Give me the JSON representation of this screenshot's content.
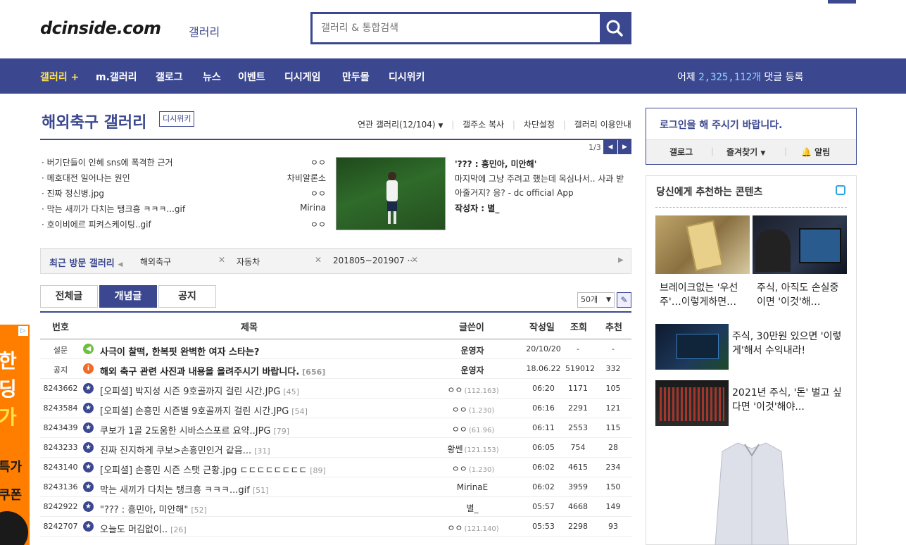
{
  "header": {
    "logo": "dcinside.com",
    "logo_sub": "갤러리",
    "search_placeholder": "갤러리 & 통합검색"
  },
  "nav": {
    "items": [
      "갤러리 +",
      "m.갤러리",
      "갤로그",
      "뉴스",
      "이벤트",
      "디시게임",
      "만두몰",
      "디시위키"
    ],
    "stat_prefix": "어제",
    "stat_count": "2,325,112개",
    "stat_suffix": "댓글 등록"
  },
  "gallery": {
    "title": "해외축구 갤러리",
    "wiki_badge": "디시위키",
    "links": [
      "연관 갤러리(12/104)",
      "갤주소 복사",
      "차단설정",
      "갤러리 이용안내"
    ]
  },
  "issue": {
    "page": "1/3",
    "items": [
      {
        "title": "버기단들이 인혜 sns에 폭격한 근거",
        "writer": "ㅇㅇ"
      },
      {
        "title": "메호대전 일어나는 원인",
        "writer": "차비알론소"
      },
      {
        "title": "진짜 정신병.jpg",
        "writer": "ㅇㅇ"
      },
      {
        "title": "막는 새끼가 다치는 탱크흥 ㅋㅋㅋ...gif",
        "writer": "Mirina"
      },
      {
        "title": "호이비에르 피켜스케이팅..gif",
        "writer": "ㅇㅇ"
      }
    ],
    "headline": "'??? : 흥민아, 미안해'",
    "body": "마지막에 그냥 주려고 했는데 옥심나서.. 사과 받아줄거지? 응? - dc official App",
    "writer_label": "작성자 :",
    "writer": "별_"
  },
  "recent": {
    "label": "최근 방문 갤러리",
    "items": [
      "해외축구",
      "자동차",
      "201805~201907 ···"
    ]
  },
  "tabs": [
    "전체글",
    "개념글",
    "공지"
  ],
  "per_page": "50개",
  "list": {
    "headers": [
      "번호",
      "제목",
      "글쓴이",
      "작성일",
      "조회",
      "추천"
    ],
    "rows": [
      {
        "no": "설문",
        "title": "사극이 찰떡, 한복핏 완벽한 여자 스타는?",
        "comments": "",
        "writer": "운영자",
        "ip": "",
        "date": "20/10/20",
        "views": "-",
        "rec": "-",
        "kind": "survey"
      },
      {
        "no": "공지",
        "title": "해외 축구 관련 사진과 내용을 올려주시기 바랍니다.",
        "comments": "[656]",
        "writer": "운영자",
        "ip": "",
        "date": "18.06.22",
        "views": "519012",
        "rec": "332",
        "kind": "notice"
      },
      {
        "no": "8243662",
        "title": "[오피셜] 박지성 시즌 9호골까지 걸린 시간.JPG",
        "comments": "[45]",
        "writer": "ㅇㅇ",
        "ip": "(112.163)",
        "date": "06:20",
        "views": "1171",
        "rec": "105",
        "kind": "star"
      },
      {
        "no": "8243584",
        "title": "[오피셜] 손흥민 시즌별 9호골까지 걸린 시간.JPG",
        "comments": "[54]",
        "writer": "ㅇㅇ",
        "ip": "(1.230)",
        "date": "06:16",
        "views": "2291",
        "rec": "121",
        "kind": "star"
      },
      {
        "no": "8243439",
        "title": "쿠보가 1골 2도움한 시바스스포르 요약..JPG",
        "comments": "[79]",
        "writer": "ㅇㅇ",
        "ip": "(61.96)",
        "date": "06:11",
        "views": "2553",
        "rec": "115",
        "kind": "star"
      },
      {
        "no": "8243233",
        "title": "진짜 진지하게 쿠보>손흥민인거 같음...",
        "comments": "[31]",
        "writer": "황쎈",
        "ip": "(121.153)",
        "date": "06:05",
        "views": "754",
        "rec": "28",
        "kind": "star"
      },
      {
        "no": "8243140",
        "title": "[오피셜] 손흥민 시즌 스탯 근황.jpg ㄷㄷㄷㄷㄷㄷㄷㄷ",
        "comments": "[89]",
        "writer": "ㅇㅇ",
        "ip": "(1.230)",
        "date": "06:02",
        "views": "4615",
        "rec": "234",
        "kind": "star"
      },
      {
        "no": "8243136",
        "title": "막는 새끼가 다치는 탱크흥 ㅋㅋㅋ...gif",
        "comments": "[51]",
        "writer": "MirinaE",
        "ip": "",
        "date": "06:02",
        "views": "3959",
        "rec": "150",
        "kind": "star"
      },
      {
        "no": "8242922",
        "title": "\"??? : 흥민아, 미안해\"",
        "comments": "[52]",
        "writer": "별_",
        "ip": "",
        "date": "05:57",
        "views": "4668",
        "rec": "149",
        "kind": "star"
      },
      {
        "no": "8242707",
        "title": "오늘도 머김없이..",
        "comments": "[26]",
        "writer": "ㅇㅇ",
        "ip": "(121.140)",
        "date": "05:53",
        "views": "2298",
        "rec": "93",
        "kind": "star"
      }
    ]
  },
  "login": {
    "message": "로그인을 해 주시기 바랍니다.",
    "links": [
      "갤로그",
      "즐겨찾기",
      "알림"
    ]
  },
  "recommend": {
    "title": "당신에게 추천하는 콘텐츠",
    "cards": [
      {
        "caption": "브레이크없는 '우선주'…이렇게하면…"
      },
      {
        "caption": "주식, 아직도 손실중이면 '이것'해…"
      }
    ],
    "list": [
      {
        "caption": "주식, 30만원 있으면 '이렇게'해서 수익내라!"
      },
      {
        "caption": "2021년 주식, '돈' 벌고 싶다면 '이것'해야..."
      }
    ]
  },
  "ad": {
    "text": [
      "한",
      "딩",
      "가",
      "특가",
      "쿠폰"
    ]
  },
  "colors": {
    "brand": "#3b4890",
    "accent_yellow": "#ffe34d",
    "ad_orange": "#ff7e00"
  }
}
